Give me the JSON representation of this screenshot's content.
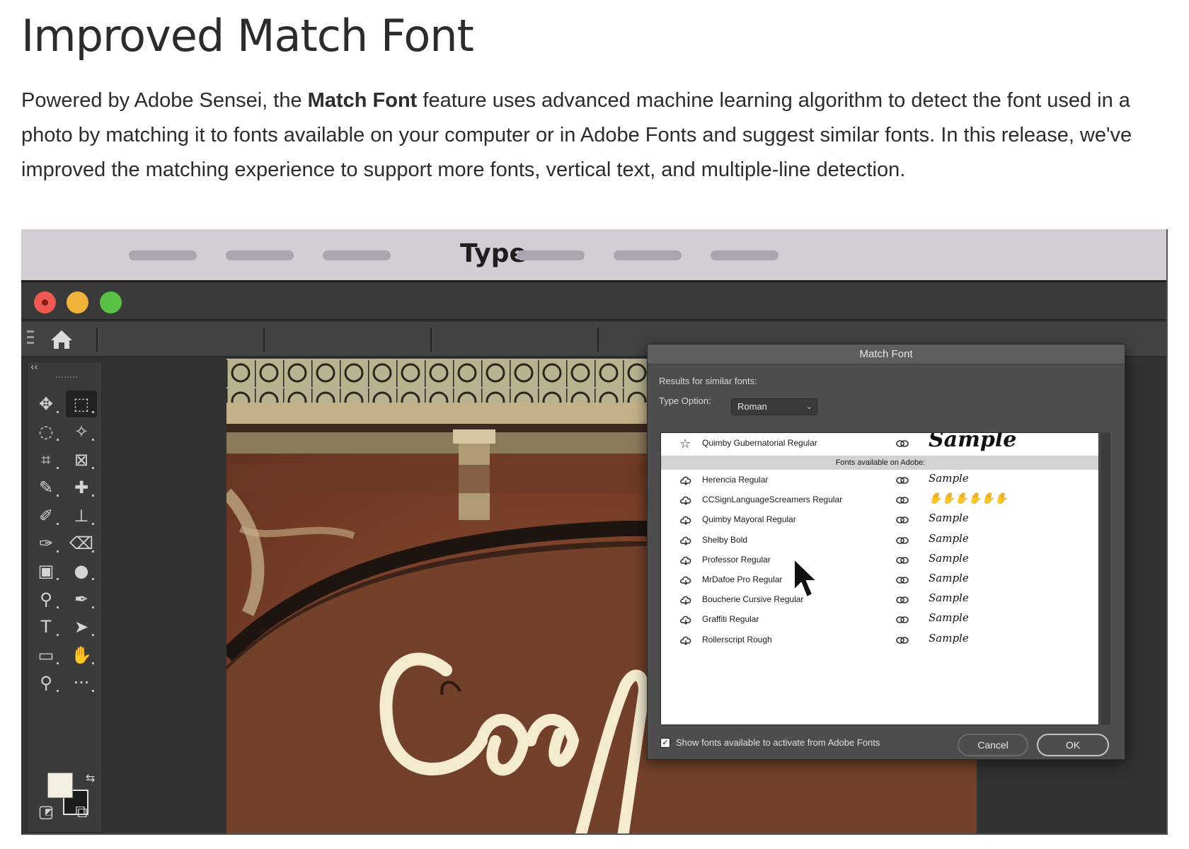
{
  "page": {
    "title": "Improved Match Font",
    "intro_before": "Powered by Adobe Sensei, the ",
    "intro_bold": "Match Font",
    "intro_after": " feature uses advanced machine learning algorithm to detect the font used in a photo by matching it to fonts available on your computer or in Adobe Fonts and suggest similar fonts. In this release, we've improved the matching experience to support more fonts, vertical text, and multiple-line detection."
  },
  "menubar": {
    "active_label": "Type"
  },
  "toolbar": {
    "tools": [
      {
        "name": "move-tool",
        "glyph": "✥"
      },
      {
        "name": "marquee-tool",
        "glyph": "⬚"
      },
      {
        "name": "lasso-tool",
        "glyph": "◌"
      },
      {
        "name": "magic-wand-tool",
        "glyph": "✧"
      },
      {
        "name": "crop-tool",
        "glyph": "⌗"
      },
      {
        "name": "frame-tool",
        "glyph": "⊠"
      },
      {
        "name": "eyedropper-tool",
        "glyph": "✎"
      },
      {
        "name": "healing-brush-tool",
        "glyph": "✚"
      },
      {
        "name": "brush-tool",
        "glyph": "✐"
      },
      {
        "name": "clone-stamp-tool",
        "glyph": "⊥"
      },
      {
        "name": "history-brush-tool",
        "glyph": "✑"
      },
      {
        "name": "eraser-tool",
        "glyph": "⌫"
      },
      {
        "name": "gradient-tool",
        "glyph": "▣"
      },
      {
        "name": "blur-tool",
        "glyph": "●"
      },
      {
        "name": "dodge-tool",
        "glyph": "⚲"
      },
      {
        "name": "pen-tool",
        "glyph": "✒"
      },
      {
        "name": "type-tool",
        "glyph": "T"
      },
      {
        "name": "path-selection-tool",
        "glyph": "➤"
      },
      {
        "name": "rectangle-tool",
        "glyph": "▭"
      },
      {
        "name": "hand-tool",
        "glyph": "✋"
      },
      {
        "name": "zoom-tool",
        "glyph": "⚲"
      },
      {
        "name": "more-tools",
        "glyph": "···"
      }
    ]
  },
  "dialog": {
    "title": "Match Font",
    "results_label": "Results for similar fonts:",
    "type_option_label": "Type Option:",
    "type_option_value": "Roman",
    "first_font": {
      "name": "Quimby Gubernatorial Regular",
      "sample": "Sample"
    },
    "adobe_header": "Fonts available on Adobe:",
    "adobe_fonts": [
      {
        "name": "Herencia Regular",
        "sample": "Sample"
      },
      {
        "name": "CCSignLanguageScreamers Regular",
        "sample": "✋✋✋✋✋✋"
      },
      {
        "name": "Quimby Mayoral Regular",
        "sample": "Sample"
      },
      {
        "name": "Shelby Bold",
        "sample": "Sample"
      },
      {
        "name": "Professor Regular",
        "sample": "Sample"
      },
      {
        "name": "MrDafoe Pro Regular",
        "sample": "Sample"
      },
      {
        "name": "Boucherie Cursive Regular",
        "sample": "Sample"
      },
      {
        "name": "Graffiti Regular",
        "sample": "Sample"
      },
      {
        "name": "Rollerscript Rough",
        "sample": "Sample"
      }
    ],
    "show_fonts_label": "Show fonts available to activate from Adobe Fonts",
    "show_fonts_checked": true,
    "cancel_label": "Cancel",
    "ok_label": "OK"
  }
}
